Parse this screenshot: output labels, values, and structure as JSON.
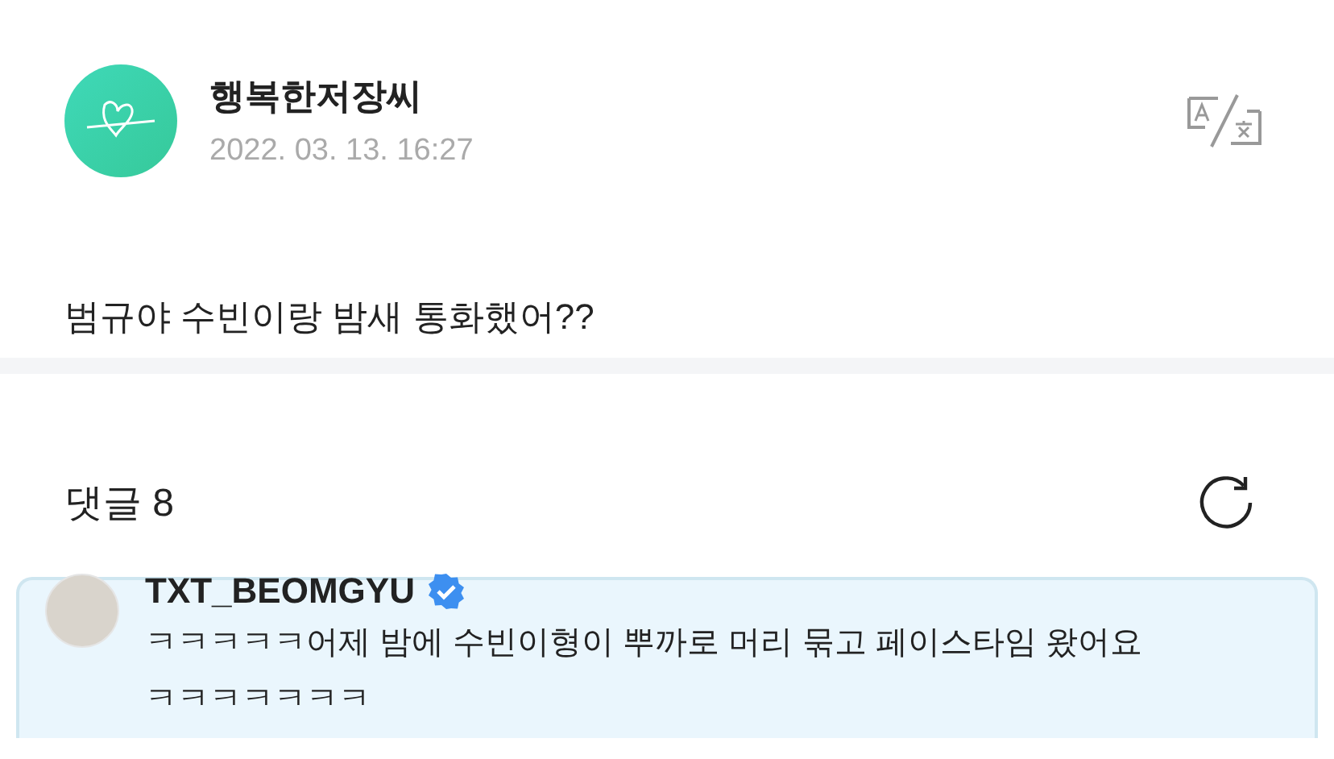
{
  "post": {
    "author": "행복한저장씨",
    "date": "2022. 03. 13. 16:27",
    "text": "범규야 수빈이랑 밤새 통화했어??"
  },
  "comments_header": {
    "label": "댓글 8"
  },
  "comments": [
    {
      "author": "TXT_BEOMGYU",
      "verified": true,
      "highlighted": true,
      "text": "ㅋㅋㅋㅋㅋ어제 밤에 수빈이형이 뿌까로 머리 묶고 페이스타임 왔어요 ㅋㅋㅋㅋㅋㅋㅋ"
    }
  ]
}
